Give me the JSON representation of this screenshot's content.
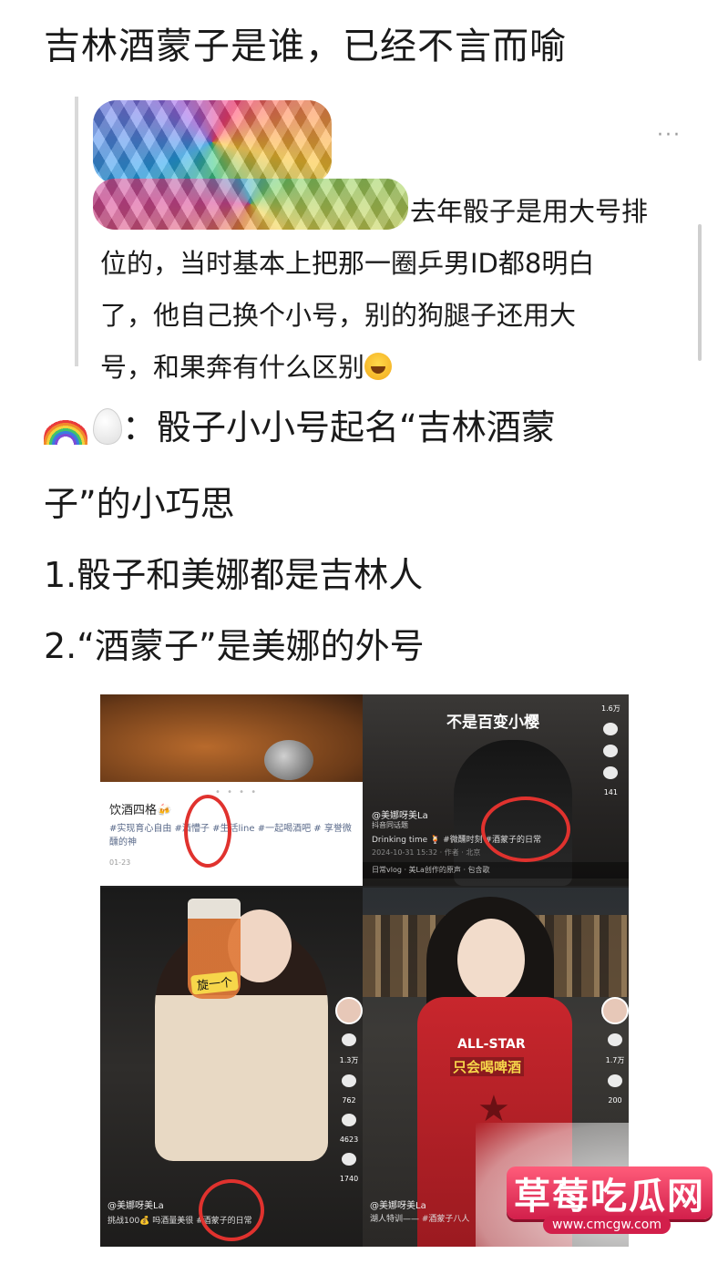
{
  "headline": "吉林酒蒙子是谁，已经不言而喻",
  "quote": {
    "more": "···",
    "lines": [
      "去年骰子是用大号排",
      "位的，当时基本上把那一圈乒男ID都8明白",
      "了，他自己换个小号，别的狗腿子还用大",
      "号，和果奔有什么区别"
    ]
  },
  "body": {
    "title_part1": "：骰子小小号起名“吉林酒蒙",
    "title_part2": "子”的小巧思",
    "point1": "1.骰子和美娜都是吉林人",
    "point2": "2.“酒蒙子”是美娜的外号"
  },
  "collage": {
    "cell1": {
      "dots": "• • • •",
      "title": "饮酒四格🍻",
      "tags": "#实现育心自由 #酒懵子 #生活line #一起喝酒吧 # 享誉微醺的神",
      "date": "01-23"
    },
    "cell2": {
      "caption": "不是百变小樱",
      "user": "@美娜呀美La",
      "sub": "抖音同话题",
      "desc": "Drinking time 🍹 #微醺时刻 #酒蒙子的日常",
      "date": "2024-10-31 15:32 · 作者 · 北京",
      "bar": "日常vlog · 美La创作的原声 · 包含歌",
      "side": [
        "1.6万",
        "",
        "",
        "141"
      ]
    },
    "cell3": {
      "sticker": "旋一个",
      "user": "@美娜呀美La",
      "desc": "挑战100💰 吗酒量美很 #酒蒙子的日常",
      "side": [
        "1.3万",
        "762",
        "4623",
        "1740"
      ]
    },
    "cell4": {
      "jersey_top": "ALL-STAR",
      "jersey_caption": "只会喝啤酒",
      "user": "@美娜呀美La",
      "desc": "湖人特训—— #酒蒙子八人",
      "side": [
        "1.7万",
        "200"
      ]
    }
  },
  "watermark": {
    "title": "草莓吃瓜网",
    "url": "www.cmcgw.com"
  },
  "colors": {
    "annotation_red": "#e0322e",
    "watermark_pink": "#d21f4b"
  }
}
